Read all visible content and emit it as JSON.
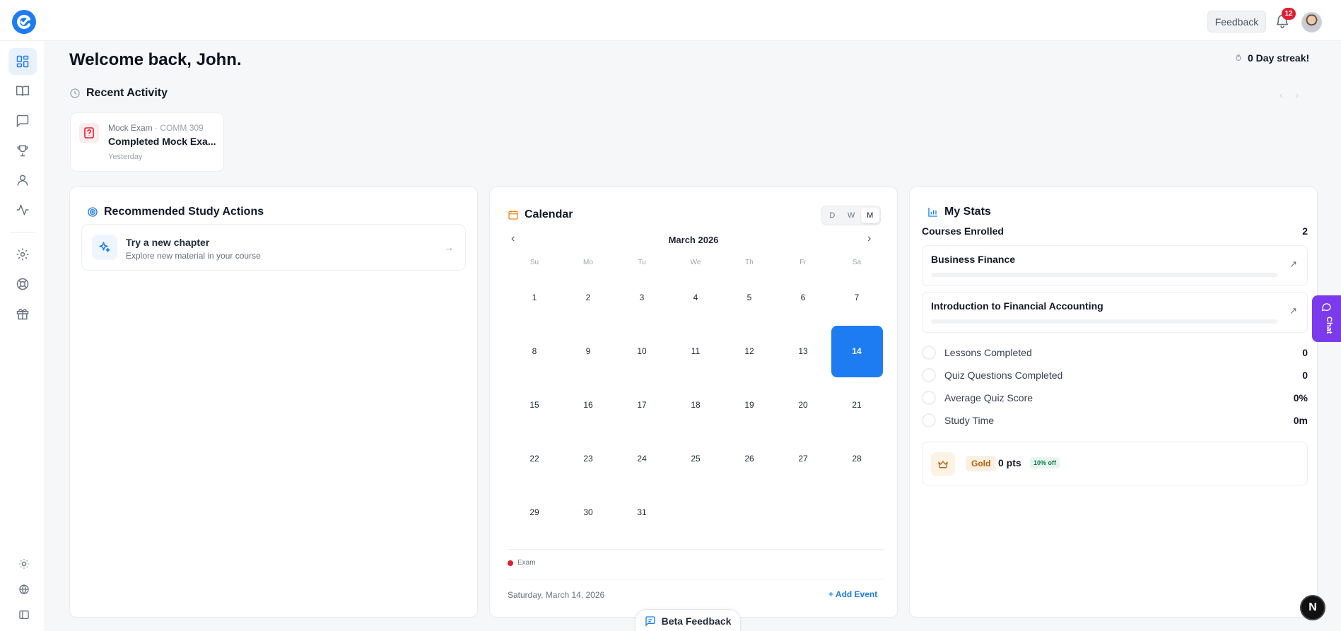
{
  "header": {
    "feedback_label": "Feedback",
    "notification_count": "12"
  },
  "main": {
    "welcome": "Welcome back, John.",
    "streak": "0 Day streak!",
    "recent_activity_title": "Recent Activity"
  },
  "recent_activity": [
    {
      "type": "Mock Exam",
      "course": "· COMM 309",
      "title": "Completed Mock Exa...",
      "time": "Yesterday"
    }
  ],
  "recommended": {
    "title": "Recommended Study Actions",
    "items": [
      {
        "title": "Try a new chapter",
        "subtitle": "Explore new material in your course"
      }
    ]
  },
  "calendar": {
    "title": "Calendar",
    "views": [
      "D",
      "W",
      "M"
    ],
    "active_view": "M",
    "month_label": "March 2026",
    "weekdays": [
      "Su",
      "Mo",
      "Tu",
      "We",
      "Th",
      "Fr",
      "Sa"
    ],
    "weeks": [
      [
        "1",
        "2",
        "3",
        "4",
        "5",
        "6",
        "7"
      ],
      [
        "8",
        "9",
        "10",
        "11",
        "12",
        "13",
        "14"
      ],
      [
        "15",
        "16",
        "17",
        "18",
        "19",
        "20",
        "21"
      ],
      [
        "22",
        "23",
        "24",
        "25",
        "26",
        "27",
        "28"
      ],
      [
        "29",
        "30",
        "31",
        "",
        "",
        "",
        ""
      ]
    ],
    "today": "14",
    "legend_exam": "Exam",
    "selected_date": "Saturday, March 14, 2026",
    "add_event": "+ Add Event"
  },
  "stats": {
    "title": "My Stats",
    "courses_enrolled_label": "Courses Enrolled",
    "courses_enrolled_value": "2",
    "courses": [
      {
        "name": "Business Finance",
        "progress": 0
      },
      {
        "name": "Introduction to Financial Accounting",
        "progress": 0
      }
    ],
    "metrics": [
      {
        "label": "Lessons Completed",
        "value": "0"
      },
      {
        "label": "Quiz Questions Completed",
        "value": "0"
      },
      {
        "label": "Average Quiz Score",
        "value": "0%"
      },
      {
        "label": "Study Time",
        "value": "0m"
      }
    ],
    "tier": {
      "name": "Gold",
      "points": "0 pts",
      "discount": "10% off"
    }
  },
  "floating": {
    "chat_label": "Chat",
    "beta_feedback": "Beta Feedback",
    "n_button": "N"
  },
  "colors": {
    "accent": "#1d7cf2",
    "chat": "#7c3aed",
    "badge": "#e11d2e",
    "tier": "#b45f06"
  }
}
